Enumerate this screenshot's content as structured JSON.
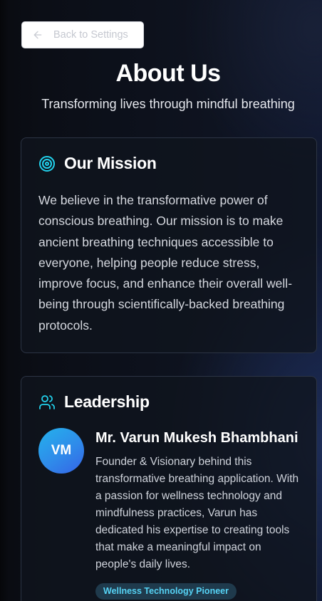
{
  "back_button": {
    "icon": "arrow-left-icon",
    "label": "Back to Settings"
  },
  "header": {
    "title": "About Us",
    "subtitle": "Transforming lives through mindful breathing"
  },
  "mission": {
    "icon": "target-icon",
    "title": "Our Mission",
    "text": "We believe in the transformative power of conscious breathing. Our mission is to make ancient breathing techniques accessible to everyone, helping people reduce stress, improve focus, and enhance their overall well-being through scientifically-backed breathing protocols."
  },
  "leadership": {
    "icon": "users-icon",
    "title": "Leadership",
    "leader": {
      "initials": "VM",
      "name": "Mr. Varun Mukesh Bhambhani",
      "bio": "Founder & Visionary behind this transformative breathing application. With a passion for wellness technology and mindfulness practices, Varun has dedicated his expertise to creating tools that make a meaningful impact on people's daily lives.",
      "badge": "Wellness Technology Pioneer"
    }
  },
  "colors": {
    "accent": "#22d3ee",
    "avatar_gradient_start": "#24b2ec",
    "avatar_gradient_end": "#3563e6",
    "badge_text": "#56d3f5",
    "badge_background": "#1f3a4c"
  }
}
